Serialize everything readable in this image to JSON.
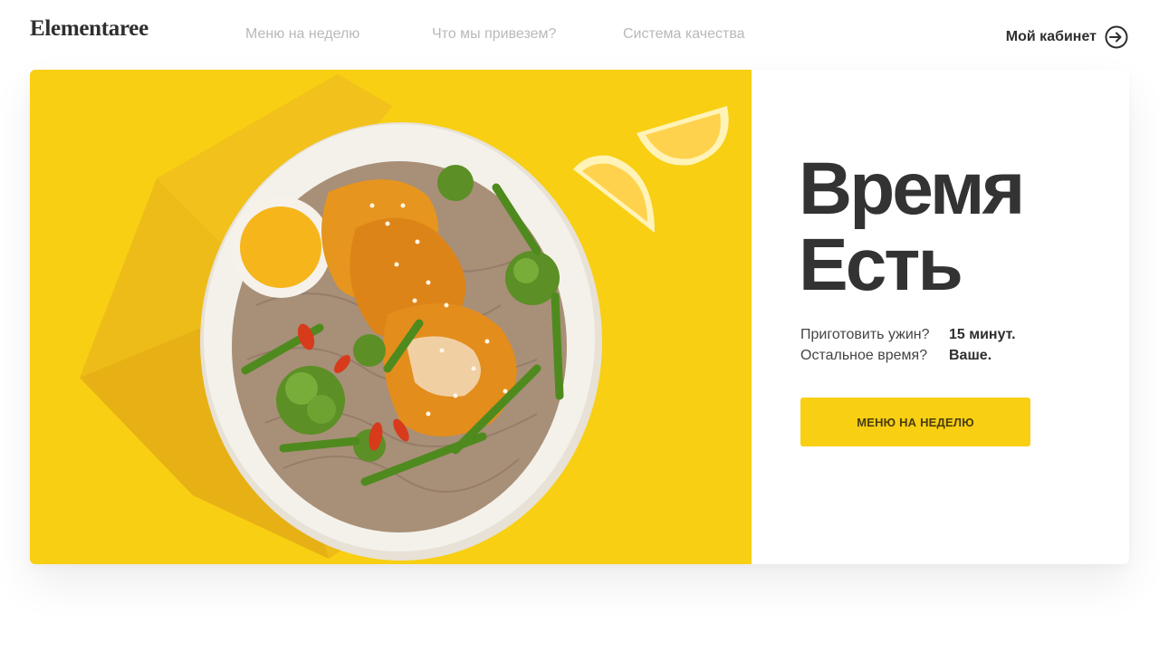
{
  "header": {
    "logo": "Elementaree",
    "nav": [
      {
        "label": "Меню на неделю"
      },
      {
        "label": "Что мы привезем?"
      },
      {
        "label": "Система качества"
      }
    ],
    "cabinet_label": "Мой кабинет"
  },
  "hero": {
    "headline_line1": "Время",
    "headline_line2": "Есть",
    "tagline": [
      {
        "question": "Приготовить ужин?",
        "answer": "15 минут."
      },
      {
        "question": "Остальное время?",
        "answer": "Ваше."
      }
    ],
    "cta_label": "МЕНЮ НА НЕДЕЛЮ"
  },
  "colors": {
    "accent_yellow": "#f8cf12",
    "text_dark": "#333333",
    "nav_gray": "#b9b9b9"
  },
  "icons": {
    "cabinet": "login-arrow-circle-icon"
  }
}
